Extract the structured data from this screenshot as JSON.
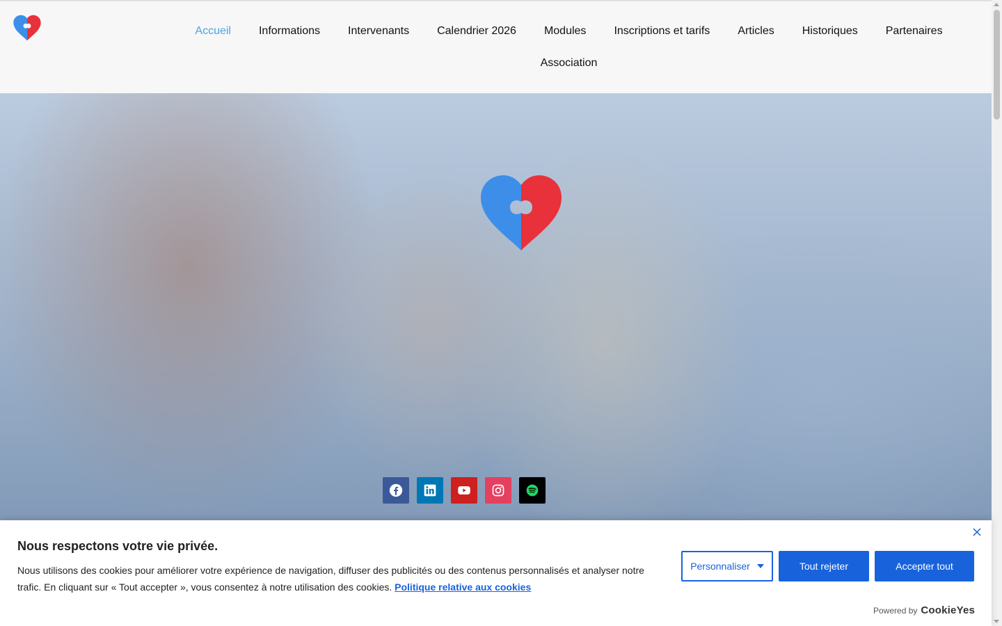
{
  "nav": {
    "items": [
      {
        "label": "Accueil",
        "active": true
      },
      {
        "label": "Informations"
      },
      {
        "label": "Intervenants"
      },
      {
        "label": "Calendrier 2026"
      },
      {
        "label": "Modules"
      },
      {
        "label": "Inscriptions et tarifs"
      },
      {
        "label": "Articles"
      },
      {
        "label": "Historiques"
      },
      {
        "label": "Partenaires"
      },
      {
        "label": "Association"
      }
    ]
  },
  "brand_colors": {
    "blue": "#3d8ee8",
    "red": "#e8313a",
    "active_nav": "#4aa3df",
    "cookie_blue": "#1863dc"
  },
  "social": [
    {
      "icon": "facebook-icon",
      "color": "#3b5998"
    },
    {
      "icon": "linkedin-icon",
      "color": "#0077b5"
    },
    {
      "icon": "youtube-icon",
      "color": "#cd201f"
    },
    {
      "icon": "instagram-icon",
      "color": "#e4405f"
    },
    {
      "icon": "spotify-icon",
      "color": "#000000"
    }
  ],
  "cookie": {
    "title": "Nous respectons votre vie privée.",
    "text": "Nous utilisons des cookies pour améliorer votre expérience de navigation, diffuser des publicités ou des contenus personnalisés et analyser notre trafic. En cliquant sur « Tout accepter », vous consentez à notre utilisation des cookies.",
    "policy_link": "Politique relative aux cookies",
    "customize": "Personnaliser",
    "reject": "Tout rejeter",
    "accept": "Accepter tout",
    "powered_by": "Powered by",
    "brand": "CookieYes"
  }
}
